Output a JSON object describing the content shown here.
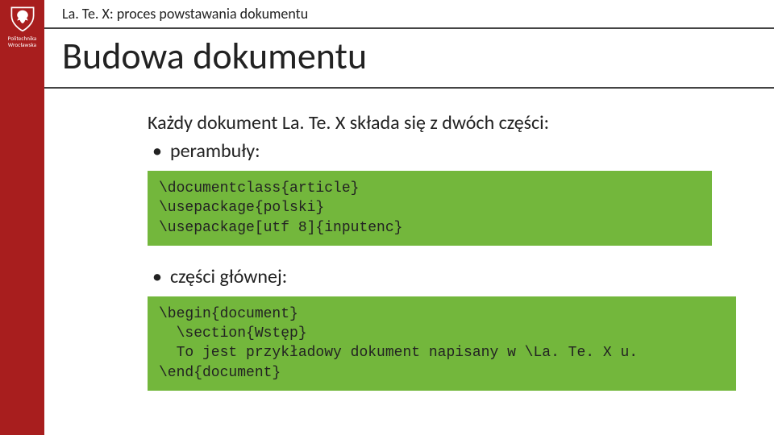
{
  "sidebar": {
    "institution_line1": "Politechnika",
    "institution_line2": "Wrocławska"
  },
  "breadcrumb": "La. Te. X: proces powstawania dokumentu",
  "title": "Budowa dokumentu",
  "intro": "Każdy dokument La. Te. X składa się z dwóch części:",
  "bullet1": "perambuły:",
  "code1": "\\documentclass{article}\n\\usepackage{polski}\n\\usepackage[utf 8]{inputenc}",
  "bullet2": "części głównej:",
  "code2": "\\begin{document}\n  \\section{Wstęp}\n  To jest przykładowy dokument napisany w \\La. Te. X u.\n\\end{document}"
}
